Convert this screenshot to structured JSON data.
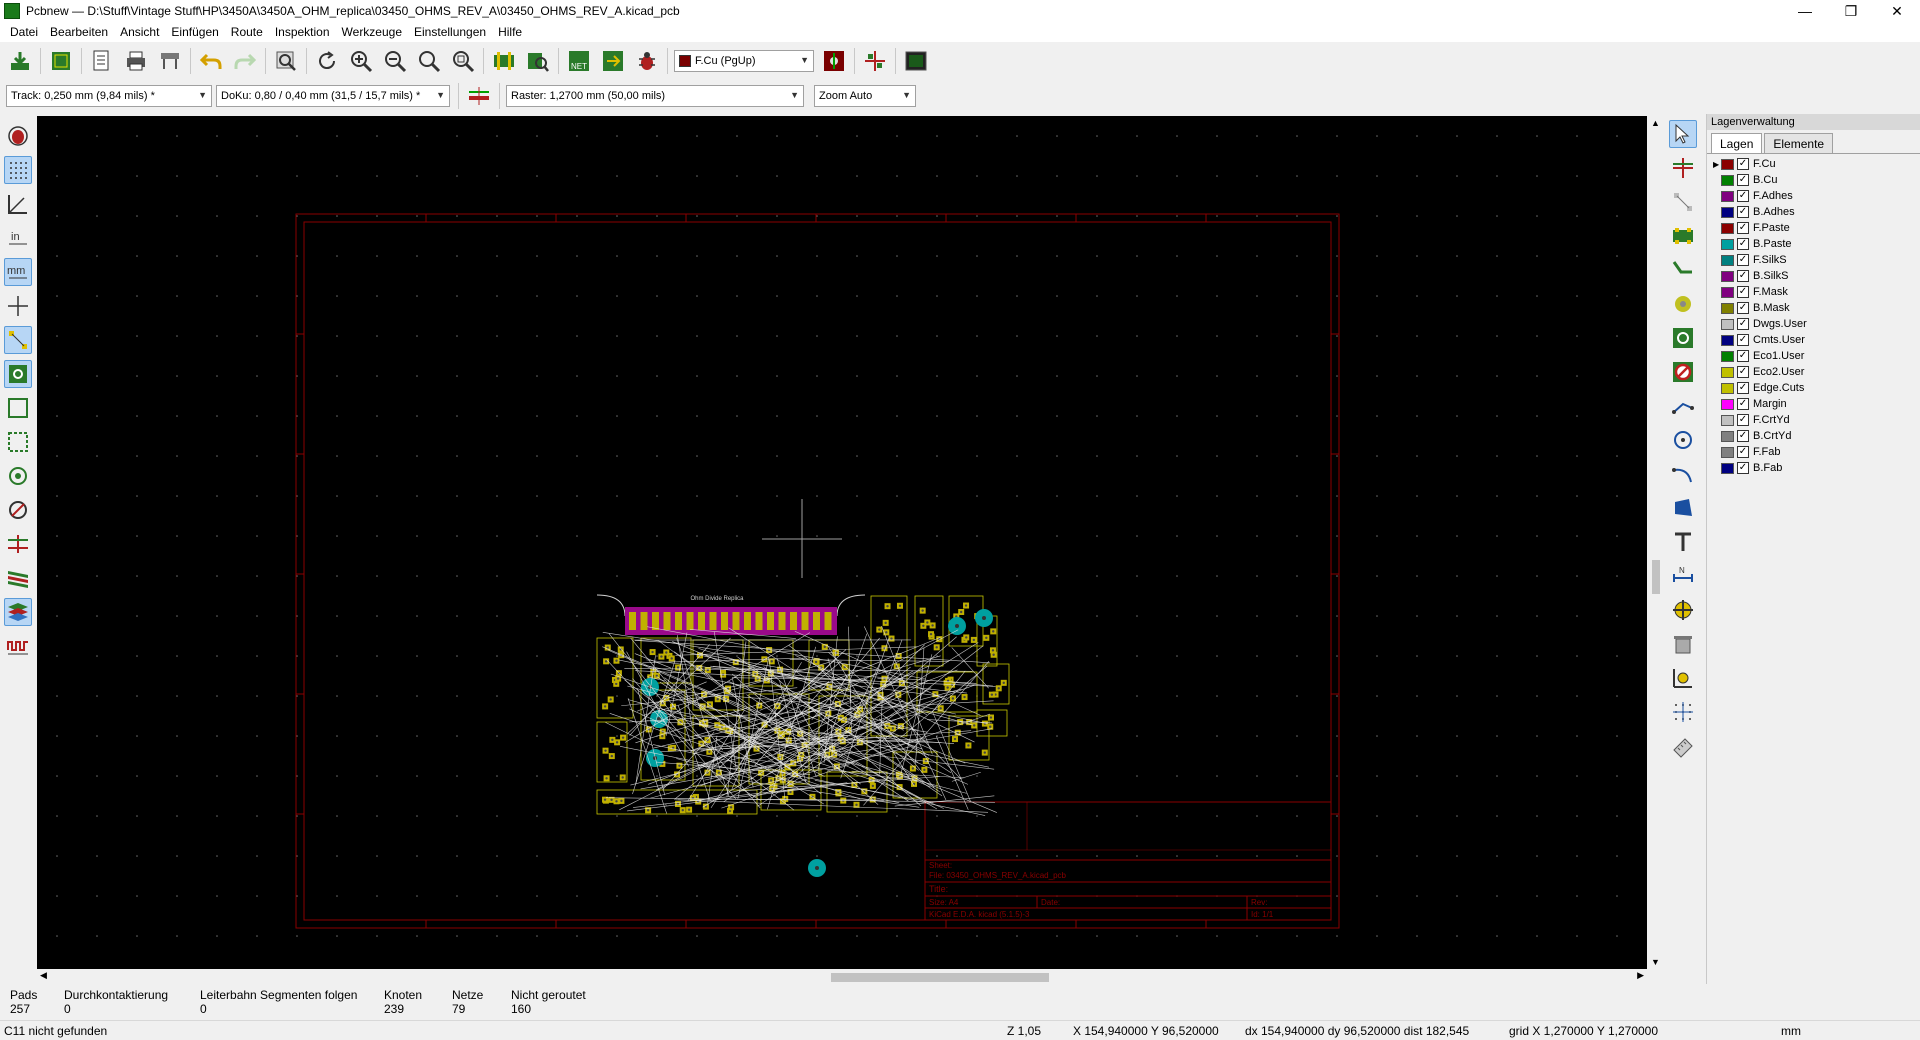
{
  "window": {
    "title": "Pcbnew — D:\\Stuff\\Vintage Stuff\\HP\\3450A\\3450A_OHM_replica\\03450_OHMS_REV_A\\03450_OHMS_REV_A.kicad_pcb",
    "minimize": "—",
    "maximize": "❐",
    "close": "✕"
  },
  "menu": [
    "Datei",
    "Bearbeiten",
    "Ansicht",
    "Einfügen",
    "Route",
    "Inspektion",
    "Werkzeuge",
    "Einstellungen",
    "Hilfe"
  ],
  "toolbar": {
    "layer_select": "F.Cu (PgUp)",
    "layer_color": "#7a0000",
    "track": "Track: 0,250 mm (9,84 mils) *",
    "via": "DoKu: 0,80 / 0,40 mm (31,5 / 15,7 mils) *",
    "grid": "Raster: 1,2700 mm (50,00 mils)",
    "zoom": "Zoom Auto"
  },
  "layers_panel": {
    "caption": "Lagenverwaltung",
    "tabs": [
      "Lagen",
      "Elemente"
    ],
    "layers": [
      {
        "name": "F.Cu",
        "color": "#8b0000",
        "checked": true,
        "active": true
      },
      {
        "name": "B.Cu",
        "color": "#008000",
        "checked": true
      },
      {
        "name": "F.Adhes",
        "color": "#800080",
        "checked": true
      },
      {
        "name": "B.Adhes",
        "color": "#000080",
        "checked": true
      },
      {
        "name": "F.Paste",
        "color": "#8b0000",
        "checked": true
      },
      {
        "name": "B.Paste",
        "color": "#00a0a0",
        "checked": true
      },
      {
        "name": "F.SilkS",
        "color": "#008080",
        "checked": true
      },
      {
        "name": "B.SilkS",
        "color": "#800080",
        "checked": true
      },
      {
        "name": "F.Mask",
        "color": "#800080",
        "checked": true
      },
      {
        "name": "B.Mask",
        "color": "#808000",
        "checked": true
      },
      {
        "name": "Dwgs.User",
        "color": "#c0c0c0",
        "checked": true
      },
      {
        "name": "Cmts.User",
        "color": "#000080",
        "checked": true
      },
      {
        "name": "Eco1.User",
        "color": "#008000",
        "checked": true
      },
      {
        "name": "Eco2.User",
        "color": "#c0c000",
        "checked": true
      },
      {
        "name": "Edge.Cuts",
        "color": "#c0c000",
        "checked": true
      },
      {
        "name": "Margin",
        "color": "#ff00ff",
        "checked": true
      },
      {
        "name": "F.CrtYd",
        "color": "#c0c0c0",
        "checked": true
      },
      {
        "name": "B.CrtYd",
        "color": "#808080",
        "checked": true
      },
      {
        "name": "F.Fab",
        "color": "#808080",
        "checked": true
      },
      {
        "name": "B.Fab",
        "color": "#000080",
        "checked": true
      }
    ]
  },
  "info": {
    "pads_label": "Pads",
    "pads": "257",
    "vias_label": "Durchkontaktierung",
    "vias": "0",
    "segments_label": "Leiterbahn Segmenten folgen",
    "segments": "0",
    "nodes_label": "Knoten",
    "nodes": "239",
    "nets_label": "Netze",
    "nets": "79",
    "unrouted_label": "Nicht geroutet",
    "unrouted": "160"
  },
  "status": {
    "message": "C11 nicht gefunden",
    "zoom": "Z 1,05",
    "abs": "X 154,940000  Y 96,520000",
    "rel": "dx 154,940000  dy 96,520000  dist 182,545",
    "grid": "grid X 1,270000  Y 1,270000",
    "units": "mm"
  },
  "board": {
    "silk_title": "Ohm Divide Replica",
    "title_block": {
      "sheet": "Sheet:",
      "file": "File: 03450_OHMS_REV_A.kicad_pcb",
      "title": "Title:",
      "size": "Size: A4",
      "date": "Date:",
      "rev": "Rev:",
      "kicad": "KiCad E.D.A.  kicad (5.1.5)-3",
      "id": "Id: 1/1"
    }
  }
}
